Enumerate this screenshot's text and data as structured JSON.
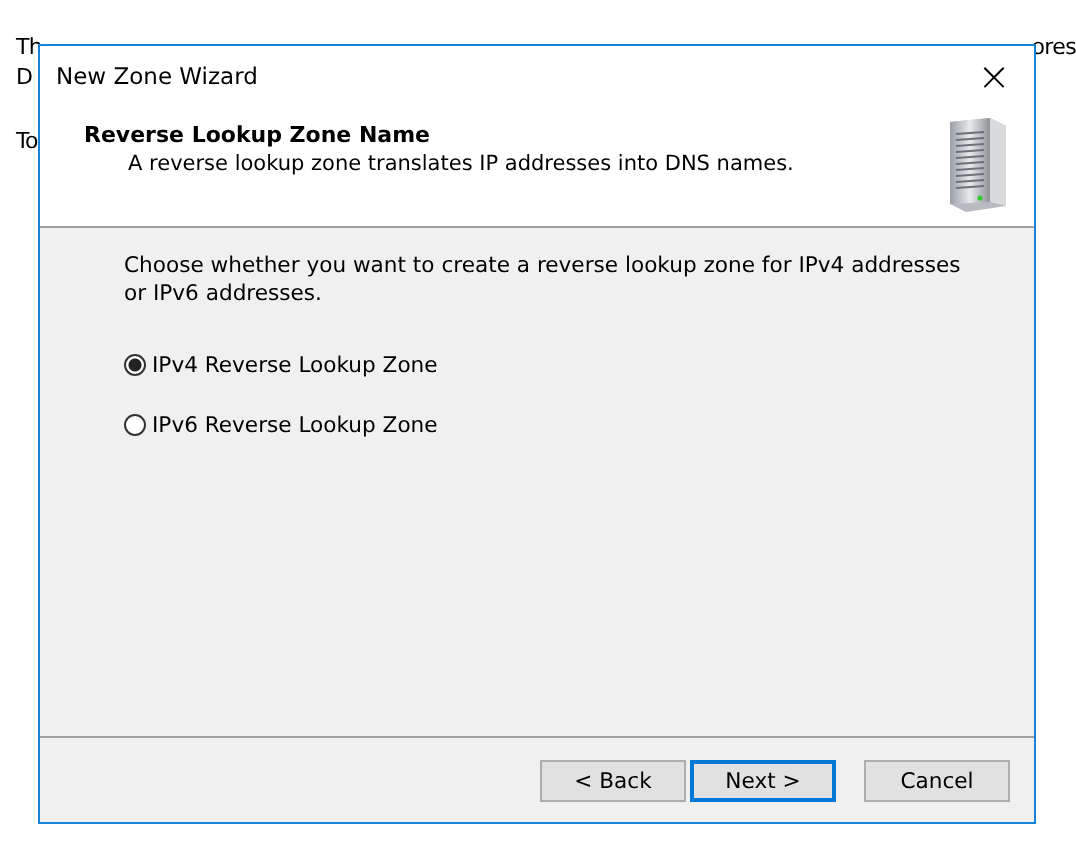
{
  "background_page": {
    "line_1_start": "Th",
    "line_1_end": "ores",
    "line_2_start": "D",
    "line_3_start": "To"
  },
  "window": {
    "title": "New Zone Wizard",
    "close": "×"
  },
  "header": {
    "title": "Reverse Lookup Zone Name",
    "subtitle": "A reverse lookup zone translates IP addresses into DNS names."
  },
  "prompt": "Choose whether you want to create a reverse lookup zone for IPv4 addresses or IPv6 addresses.",
  "options": [
    {
      "label": "IPv4 Reverse Lookup Zone",
      "selected": true
    },
    {
      "label": "IPv6 Reverse Lookup Zone",
      "selected": false
    }
  ],
  "buttons": [
    {
      "label": "< Back",
      "default": false
    },
    {
      "label": "Next >",
      "default": true
    },
    {
      "label": "Cancel",
      "default": false
    }
  ]
}
